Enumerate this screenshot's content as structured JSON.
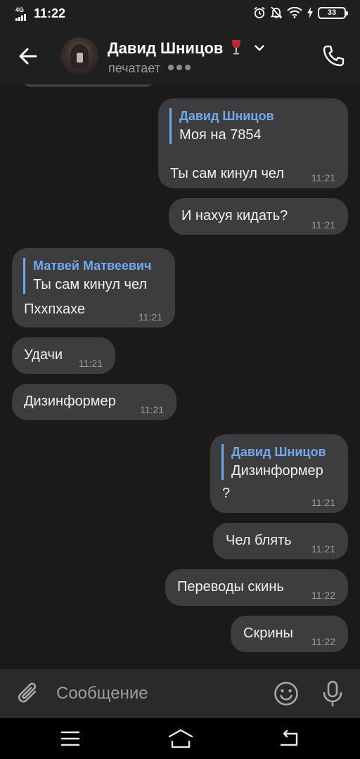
{
  "status_bar": {
    "network": "4G",
    "time": "11:22",
    "battery": "33",
    "icons": [
      "alarm-icon",
      "mute-bell-icon",
      "wifi-icon",
      "charging-icon"
    ]
  },
  "header": {
    "contact_name": "Давид Шницов",
    "status": "печатает"
  },
  "messages": [
    {
      "side": "out",
      "reply_author": "Давид Шницов",
      "reply_text": "Моя на 7854",
      "text": "Ты сам кинул чел",
      "time": "11:21"
    },
    {
      "side": "out",
      "text": "И нахуя кидать?",
      "time": "11:21"
    },
    {
      "side": "in",
      "reply_author": "Матвей Матвеевич",
      "reply_text": "Ты сам кинул чел",
      "text": "Пххпхахе",
      "time": "11:21"
    },
    {
      "side": "in",
      "text": "Удачи",
      "time": "11:21"
    },
    {
      "side": "in",
      "text": "Дизинформер",
      "time": "11:21"
    },
    {
      "side": "out",
      "reply_author": "Давид Шницов",
      "reply_text": "Дизинформер",
      "text": "?",
      "time": "11:21"
    },
    {
      "side": "out",
      "text": "Чел блять",
      "time": "11:21"
    },
    {
      "side": "out",
      "text": "Переводы скинь",
      "time": "11:22"
    },
    {
      "side": "out",
      "text": "Скрины",
      "time": "11:22"
    }
  ],
  "composer": {
    "placeholder": "Сообщение"
  },
  "colors": {
    "background": "#1a1a1a",
    "bubble": "#3d3d3f",
    "accent": "#71aaeb"
  }
}
